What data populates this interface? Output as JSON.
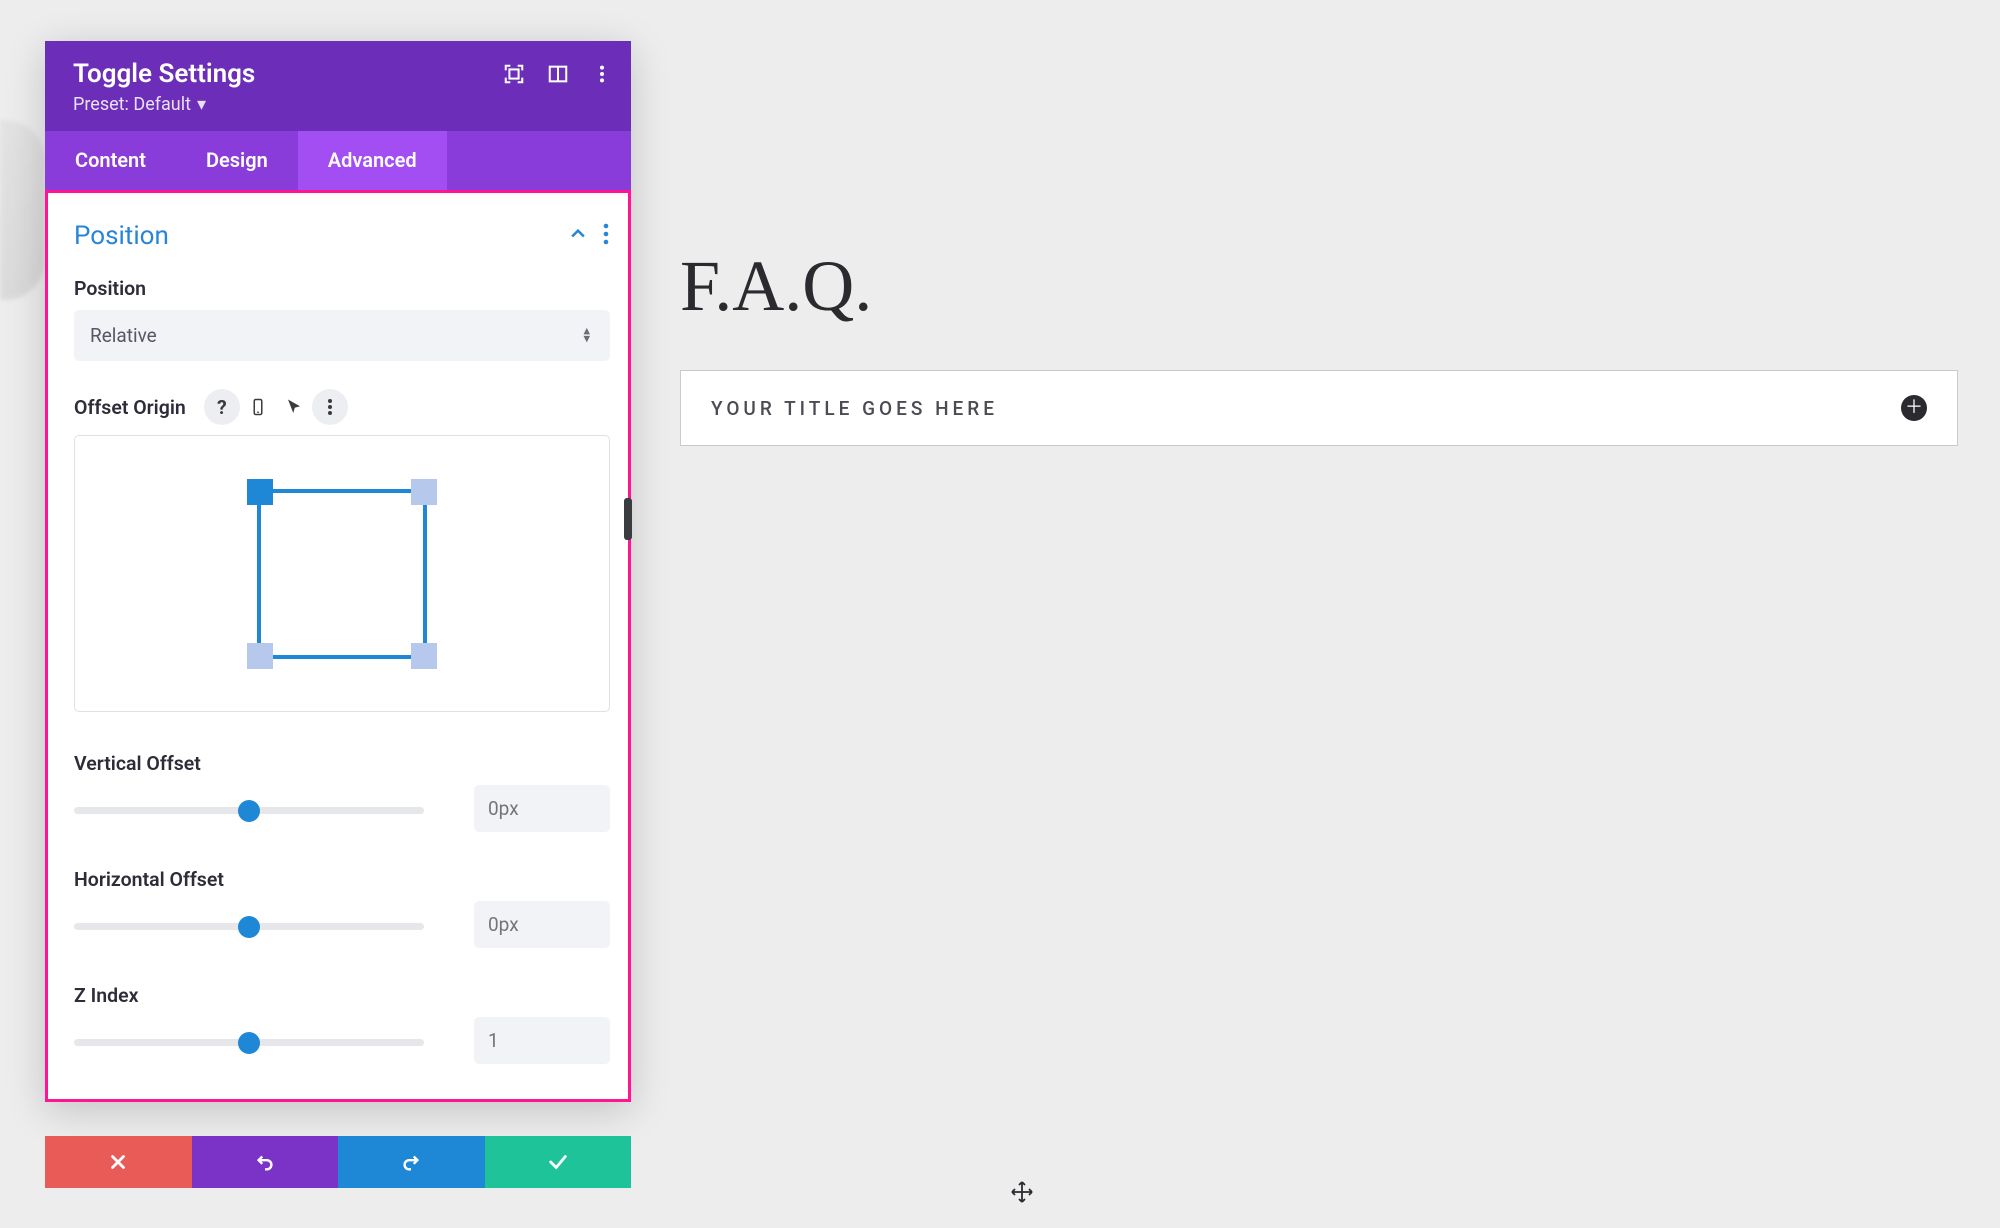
{
  "panel": {
    "title": "Toggle Settings",
    "preset_label": "Preset: Default",
    "tabs": {
      "content": "Content",
      "design": "Design",
      "advanced": "Advanced"
    },
    "section": {
      "title": "Position",
      "position_label": "Position",
      "position_value": "Relative",
      "offset_origin_label": "Offset Origin",
      "vertical_offset_label": "Vertical Offset",
      "vertical_offset_value": "0px",
      "horizontal_offset_label": "Horizontal Offset",
      "horizontal_offset_value": "0px",
      "z_index_label": "Z Index",
      "z_index_value": "1"
    }
  },
  "canvas": {
    "heading": "F.A.Q.",
    "toggle_title": "YOUR TITLE GOES HERE"
  }
}
